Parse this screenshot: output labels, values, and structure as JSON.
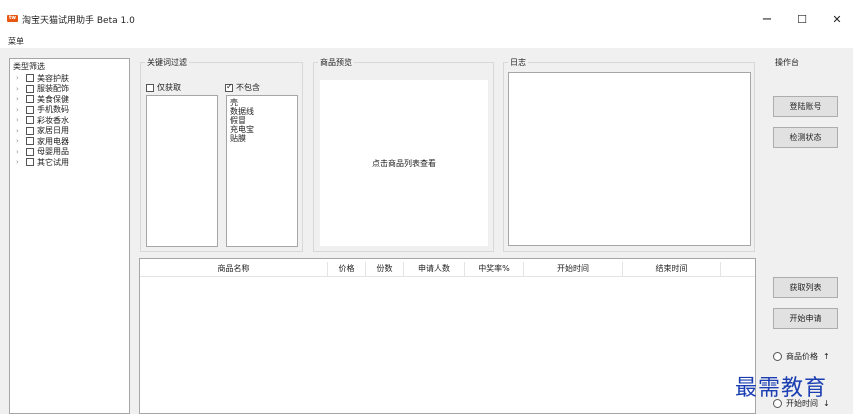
{
  "window": {
    "title": "淘宝天猫试用助手 Beta 1.0",
    "minimize_glyph": "−",
    "maximize_glyph": "☐",
    "close_glyph": "✕"
  },
  "menu": {
    "label": "菜单"
  },
  "category_panel": {
    "title": "类型筛选",
    "items": [
      {
        "label": "美容护肤",
        "checked": false
      },
      {
        "label": "服装配饰",
        "checked": false
      },
      {
        "label": "美食保健",
        "checked": false
      },
      {
        "label": "手机数码",
        "checked": false
      },
      {
        "label": "彩妆香水",
        "checked": false
      },
      {
        "label": "家居日用",
        "checked": false
      },
      {
        "label": "家用电器",
        "checked": false
      },
      {
        "label": "母婴用品",
        "checked": false
      },
      {
        "label": "其它试用",
        "checked": false
      }
    ]
  },
  "keyword_filter": {
    "title": "关键词过滤",
    "only_fetch_label": "仅获取",
    "only_fetch_checked": false,
    "exclude_label": "不包含",
    "exclude_checked": true,
    "include_lines": [],
    "exclude_lines": [
      "壳",
      "数据线",
      "假冒",
      "充电宝",
      "贴膜"
    ]
  },
  "preview": {
    "title": "商品预览",
    "placeholder": "点击商品列表查看"
  },
  "log": {
    "title": "日志"
  },
  "console": {
    "title": "操作台",
    "login_button": "登陆账号",
    "check_button": "检测状态",
    "fetch_button": "获取列表",
    "apply_button": "开始申请"
  },
  "table": {
    "columns": [
      "商品名称",
      "价格",
      "份数",
      "申请人数",
      "中奖率%",
      "开始时间",
      "结束时间"
    ],
    "rows": []
  },
  "sort_options": [
    {
      "label": "商品价格",
      "arrow": "↑"
    },
    {
      "label": "开始时间",
      "arrow": "↓"
    }
  ],
  "watermark": "最需教育"
}
